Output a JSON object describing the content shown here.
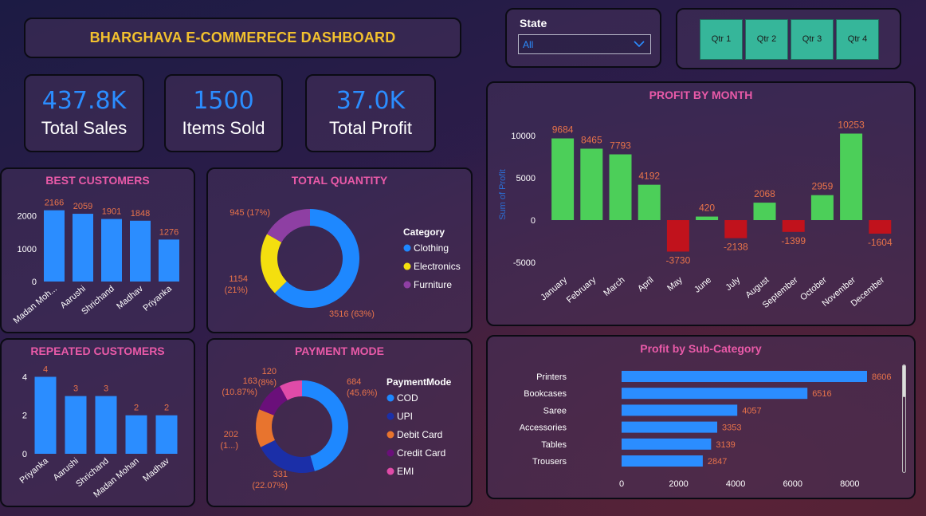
{
  "header": {
    "title": "BHARGHAVA E-COMMERECE DASHBOARD"
  },
  "kpis": [
    {
      "value": "437.8K",
      "label": "Total Sales"
    },
    {
      "value": "1500",
      "label": "Items Sold"
    },
    {
      "value": "37.0K",
      "label": "Total Profit"
    }
  ],
  "filter": {
    "label": "State",
    "selected": "All"
  },
  "quarters": [
    "Qtr 1",
    "Qtr 2",
    "Qtr 3",
    "Qtr 4"
  ],
  "colors": {
    "accent": "#2b8dff",
    "title": "#f2c12e",
    "pink": "#e95aa8",
    "positive": "#4ccf59",
    "negative": "#c1121c",
    "label": "#e8734a"
  },
  "chart_data": [
    {
      "id": "best_customers",
      "type": "bar",
      "title": "BEST CUSTOMERS",
      "categories": [
        "Madan Moh...",
        "Aarushi",
        "Shrichand",
        "Madhav",
        "Priyanka"
      ],
      "values": [
        2166,
        2059,
        1901,
        1848,
        1276
      ],
      "yticks": [
        0,
        1000,
        2000
      ],
      "ylim": [
        0,
        2400
      ]
    },
    {
      "id": "total_quantity",
      "type": "pie",
      "title": "TOTAL QUANTITY",
      "legend_title": "Category",
      "slices": [
        {
          "name": "Clothing",
          "value": 3516,
          "label": "3516 (63%)",
          "color": "#1e88ff"
        },
        {
          "name": "Electronics",
          "value": 1154,
          "label": "1154 (21%)",
          "color": "#f4df0f"
        },
        {
          "name": "Furniture",
          "value": 945,
          "label": "945 (17%)",
          "color": "#8e3fa3"
        }
      ]
    },
    {
      "id": "repeated_customers",
      "type": "bar",
      "title": "REPEATED CUSTOMERS",
      "categories": [
        "Priyanka",
        "Aarushi",
        "Shrichand",
        "Madan Mohan",
        "Madhav"
      ],
      "values": [
        4,
        3,
        3,
        2,
        2
      ],
      "yticks": [
        0,
        2,
        4
      ],
      "ylim": [
        0,
        4.6
      ]
    },
    {
      "id": "payment_mode",
      "type": "pie",
      "title": "PAYMENT MODE",
      "legend_title": "PaymentMode",
      "slices": [
        {
          "name": "COD",
          "value": 684,
          "label": "684 (45.6%)",
          "color": "#1e88ff"
        },
        {
          "name": "UPI",
          "value": 331,
          "label": "331 (22.07%)",
          "color": "#1b2fa8"
        },
        {
          "name": "Debit Card",
          "value": 202,
          "label": "202 (1...)",
          "color": "#e8742e"
        },
        {
          "name": "Credit Card",
          "value": 163,
          "label": "163 (10.87%)",
          "color": "#6a0f7a"
        },
        {
          "name": "EMI",
          "value": 120,
          "label": "120 (8%)",
          "color": "#e04ba8"
        }
      ]
    },
    {
      "id": "profit_by_month",
      "type": "bar",
      "title": "PROFIT BY MONTH",
      "ylabel": "Sum of Profit",
      "categories": [
        "January",
        "February",
        "March",
        "April",
        "May",
        "June",
        "July",
        "August",
        "September",
        "October",
        "November",
        "December"
      ],
      "values": [
        9684,
        8465,
        7793,
        4192,
        -3730,
        420,
        -2138,
        2068,
        -1399,
        2959,
        10253,
        -1604
      ],
      "yticks": [
        -5000,
        0,
        5000,
        10000
      ],
      "ylim": [
        -5500,
        11500
      ]
    },
    {
      "id": "profit_by_subcategory",
      "type": "bar",
      "orientation": "horizontal",
      "title": "Profit by Sub-Category",
      "categories": [
        "Printers",
        "Bookcases",
        "Saree",
        "Accessories",
        "Tables",
        "Trousers"
      ],
      "values": [
        8606,
        6516,
        4057,
        3353,
        3139,
        2847
      ],
      "xticks": [
        0,
        2000,
        4000,
        6000,
        8000
      ],
      "xlim": [
        0,
        8700
      ]
    }
  ]
}
